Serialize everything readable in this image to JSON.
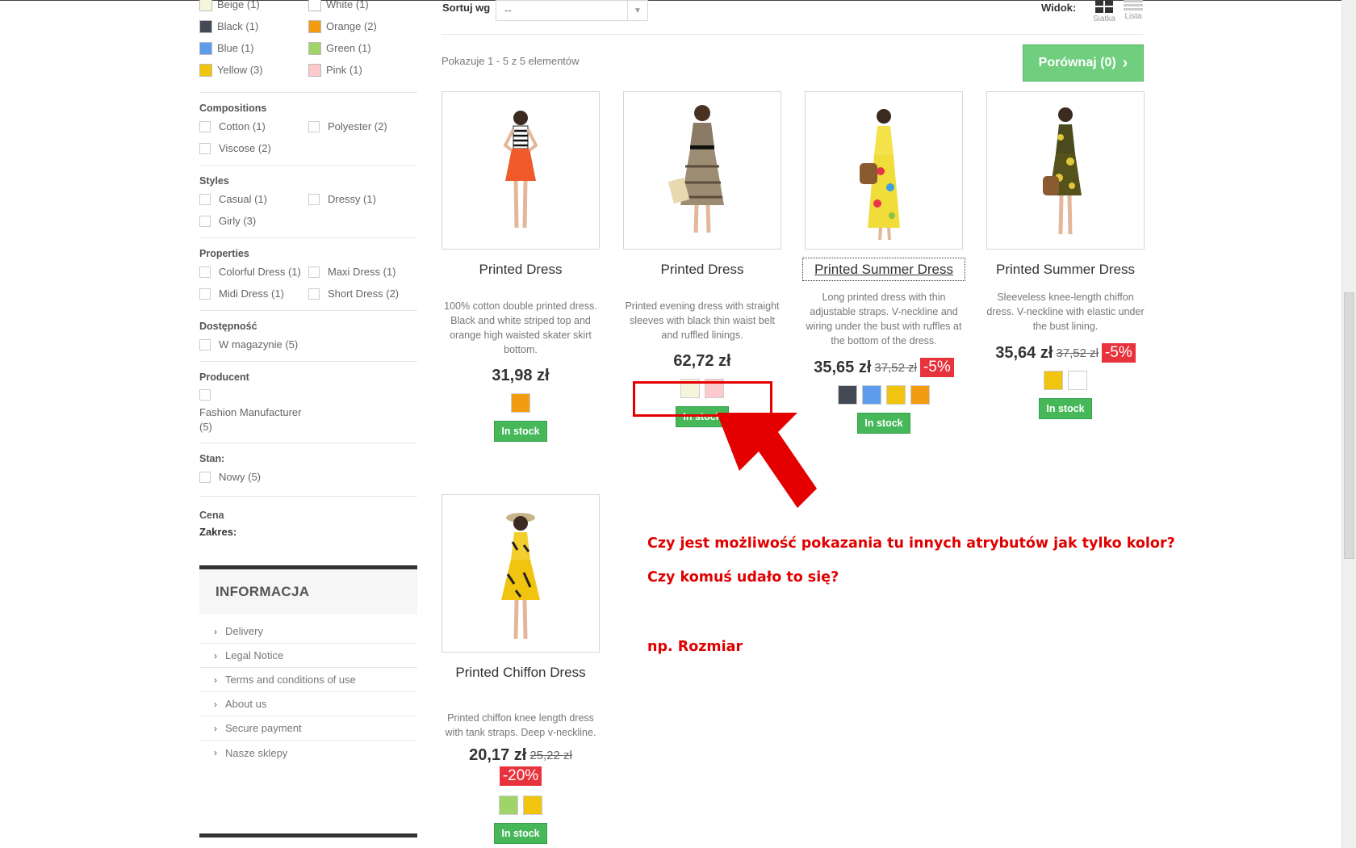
{
  "filters": {
    "colors": [
      {
        "label": "Beige (1)",
        "color": "#f5f5dc"
      },
      {
        "label": "White (1)",
        "color": "#ffffff"
      },
      {
        "label": "Black (1)",
        "color": "#434a54"
      },
      {
        "label": "Orange (2)",
        "color": "#f39c11"
      },
      {
        "label": "Blue (1)",
        "color": "#5d9cec"
      },
      {
        "label": "Green (1)",
        "color": "#a0d468"
      },
      {
        "label": "Yellow (3)",
        "color": "#f1c40f"
      },
      {
        "label": "Pink (1)",
        "color": "#fccacd"
      }
    ],
    "compositions": {
      "title": "Compositions",
      "options": [
        "Cotton (1)",
        "Polyester (2)",
        "Viscose (2)"
      ]
    },
    "styles": {
      "title": "Styles",
      "options": [
        "Casual (1)",
        "Dressy (1)",
        "Girly (3)"
      ]
    },
    "properties": {
      "title": "Properties",
      "options": [
        "Colorful Dress (1)",
        "Maxi Dress (1)",
        "Midi Dress (1)",
        "Short Dress (2)"
      ]
    },
    "availability": {
      "title": "Dostępność",
      "options": [
        "W magazynie (5)"
      ]
    },
    "manufacturer": {
      "title": "Producent",
      "option": "Fashion Manufacturer (5)"
    },
    "condition": {
      "title": "Stan:",
      "options": [
        "Nowy (5)"
      ]
    },
    "price": {
      "title": "Cena",
      "range_label": "Zakres:"
    }
  },
  "info": {
    "title": "INFORMACJA",
    "items": [
      "Delivery",
      "Legal Notice",
      "Terms and conditions of use",
      "About us",
      "Secure payment",
      "Nasze sklepy"
    ]
  },
  "toolbar": {
    "sort_label": "Sortuj wg",
    "sort_value": "--",
    "view_label": "Widok:",
    "grid_label": "Siatka",
    "list_label": "Lista",
    "showing": "Pokazuje 1 - 5 z 5 elementów",
    "compare": "Porównaj (0)"
  },
  "products": [
    {
      "name": "Printed Dress",
      "desc": "100% cotton double printed dress. Black and white striped top and orange high waisted skater skirt bottom.",
      "price": "31,98 zł",
      "old_price": "",
      "discount": "",
      "colors": [
        "#f39c11"
      ],
      "stock": "In stock"
    },
    {
      "name": "Printed Dress",
      "desc": "Printed evening dress with straight sleeves with black thin waist belt and ruffled linings.",
      "price": "62,72 zł",
      "old_price": "",
      "discount": "",
      "colors": [
        "#f5f5dc",
        "#fccacd"
      ],
      "stock": "In stock"
    },
    {
      "name": "Printed Summer Dress",
      "desc": "Long printed dress with thin adjustable straps. V-neckline and wiring under the bust with ruffles at the bottom of the dress.",
      "price": "35,65 zł",
      "old_price": "37,52 zł",
      "discount": "-5%",
      "colors": [
        "#434a54",
        "#5d9cec",
        "#f1c40f",
        "#f39c11"
      ],
      "stock": "In stock"
    },
    {
      "name": "Printed Summer Dress",
      "desc": "Sleeveless knee-length chiffon dress. V-neckline with elastic under the bust lining.",
      "price": "35,64 zł",
      "old_price": "37,52 zł",
      "discount": "-5%",
      "colors": [
        "#f1c40f",
        "#ffffff"
      ],
      "stock": "In stock"
    },
    {
      "name": "Printed Chiffon Dress",
      "desc": "Printed chiffon knee length dress with tank straps. Deep v-neckline.",
      "price": "20,17 zł",
      "old_price": "25,22 zł",
      "discount": "-20%",
      "colors": [
        "#a0d468",
        "#f1c40f"
      ],
      "stock": "In stock"
    }
  ],
  "annotation": {
    "line1": "Czy jest możliwość pokazania tu innych atrybutów jak tylko kolor?",
    "line2": "Czy komuś udało to się?",
    "line3": "np. Rozmiar",
    "color": "#e00000"
  }
}
